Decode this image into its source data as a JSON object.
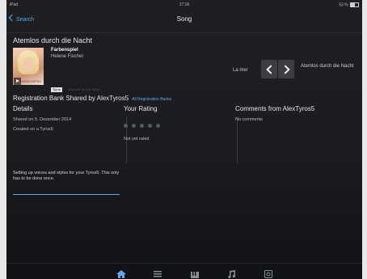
{
  "status": {
    "left": "iPad",
    "time": "17:16",
    "battery": "53 %"
  },
  "nav": {
    "back_label": "Search",
    "title": "Song"
  },
  "song": {
    "title": "Atemlos durch die Nacht",
    "album": "Farbenspiel",
    "artist": "Helene Fischer",
    "cover_text": "FARBENSPIEL",
    "tag": "Tyros",
    "tag_extra": "Genesis Tyros5 Offline"
  },
  "player": {
    "prev_song": "La mer",
    "next_song": "Atemlos durch die Nacht"
  },
  "registration": {
    "title": "Registration Bank Shared by AlexTyros5",
    "link": "All Registration Banks"
  },
  "details": {
    "header": "Details",
    "shared": "Shared on 5. Dezember 2014",
    "created": "Created on a Tyros5"
  },
  "rating": {
    "header": "Your Rating",
    "status": "Not yet rated",
    "stars": 0,
    "max_stars": 5
  },
  "comments": {
    "header": "Comments from AlexTyros5",
    "status": "No comments"
  },
  "setup": {
    "text": "Setting up voices and styles for your Tyros5. This only has to be done once.",
    "progress": 1
  },
  "tabs": [
    {
      "icon": "home-icon",
      "active": true
    },
    {
      "icon": "list-icon",
      "active": false
    },
    {
      "icon": "keyboard-icon",
      "active": false
    },
    {
      "icon": "music-note-icon",
      "active": false
    },
    {
      "icon": "settings-icon",
      "active": false
    }
  ],
  "colors": {
    "accent": "#5fa9e6",
    "background": "#1b1d21",
    "text": "#d9d9d9"
  }
}
